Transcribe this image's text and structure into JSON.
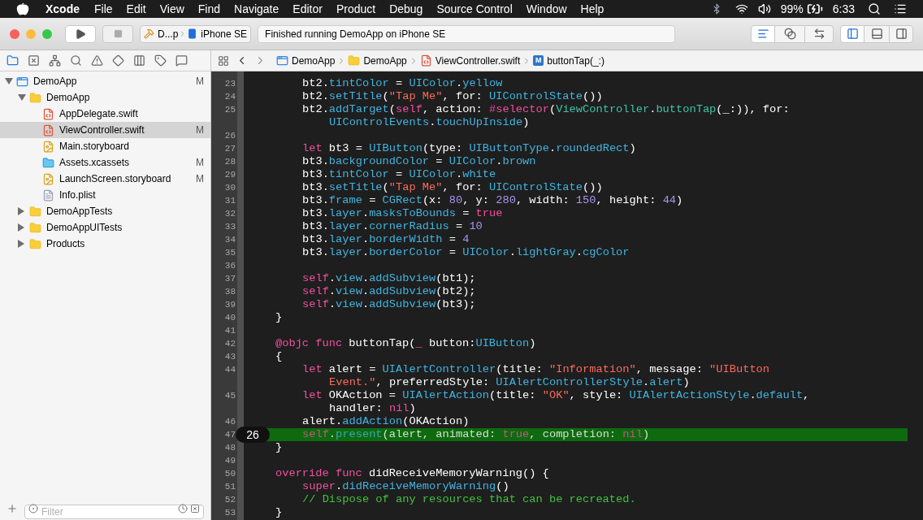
{
  "menu_bar": {
    "app": "Xcode",
    "items": [
      "File",
      "Edit",
      "View",
      "Find",
      "Navigate",
      "Editor",
      "Product",
      "Debug",
      "Source Control",
      "Window",
      "Help"
    ],
    "battery": "99%",
    "time": "6:33"
  },
  "toolbar": {
    "scheme": "D...p",
    "device": "iPhone SE",
    "activity": "Finished running DemoApp on iPhone SE"
  },
  "navigator_tabs": [
    {
      "kind": "project",
      "selected": true
    },
    {
      "kind": "source",
      "selected": false
    },
    {
      "kind": "symbol",
      "selected": false
    },
    {
      "kind": "find",
      "selected": false
    },
    {
      "kind": "issue",
      "selected": false
    },
    {
      "kind": "test",
      "selected": false
    },
    {
      "kind": "debug",
      "selected": false
    },
    {
      "kind": "breakpoint",
      "selected": false
    },
    {
      "kind": "report",
      "selected": false
    }
  ],
  "tree": [
    {
      "name": "DemoApp",
      "kind": "project",
      "status": "M",
      "selected": false,
      "expanded": true,
      "children": [
        {
          "name": "DemoApp",
          "kind": "folder",
          "selected": false,
          "expanded": true,
          "children": [
            {
              "name": "AppDelegate.swift",
              "kind": "swift",
              "selected": false
            },
            {
              "name": "ViewController.swift",
              "kind": "swift",
              "status": "M",
              "selected": true
            },
            {
              "name": "Main.storyboard",
              "kind": "storyboard",
              "selected": false
            },
            {
              "name": "Assets.xcassets",
              "kind": "assets",
              "status": "M",
              "selected": false
            },
            {
              "name": "LaunchScreen.storyboard",
              "kind": "storyboard",
              "status": "M",
              "selected": false
            },
            {
              "name": "Info.plist",
              "kind": "plist",
              "selected": false
            }
          ]
        },
        {
          "name": "DemoAppTests",
          "kind": "folder",
          "selected": false,
          "expanded": false
        },
        {
          "name": "DemoAppUITests",
          "kind": "folder",
          "selected": false,
          "expanded": false
        },
        {
          "name": "Products",
          "kind": "folder",
          "selected": false,
          "expanded": false
        }
      ]
    }
  ],
  "filter": {
    "placeholder": "Filter"
  },
  "breadcrumb": [
    {
      "text": "DemoApp",
      "kind": "project"
    },
    {
      "text": "DemoApp",
      "kind": "folder"
    },
    {
      "text": "ViewController.swift",
      "kind": "swift"
    },
    {
      "text": "buttonTap(_:)",
      "kind": "method",
      "badge": "M"
    }
  ],
  "code": [
    {
      "number": "23",
      "kind": "body",
      "tokens": [
        {
          "kind": "plain",
          "text": "bt2."
        },
        {
          "kind": "id",
          "text": "tintColor"
        },
        {
          "kind": "plain",
          "text": " = "
        },
        {
          "kind": "id",
          "text": "UIColor"
        },
        {
          "kind": "plain",
          "text": "."
        },
        {
          "kind": "id",
          "text": "yellow"
        }
      ]
    },
    {
      "number": "24",
      "kind": "body",
      "tokens": [
        {
          "kind": "plain",
          "text": "bt2."
        },
        {
          "kind": "id",
          "text": "setTitle"
        },
        {
          "kind": "plain",
          "text": "("
        },
        {
          "kind": "string",
          "text": "\"Tap Me\""
        },
        {
          "kind": "plain",
          "text": ", for: "
        },
        {
          "kind": "id",
          "text": "UIControlState"
        },
        {
          "kind": "plain",
          "text": "())"
        }
      ]
    },
    {
      "number": "25",
      "kind": "body",
      "tokens": [
        {
          "kind": "plain",
          "text": "bt2."
        },
        {
          "kind": "id",
          "text": "addTarget"
        },
        {
          "kind": "plain",
          "text": "("
        },
        {
          "kind": "keyword",
          "text": "self"
        },
        {
          "kind": "plain",
          "text": ", action: "
        },
        {
          "kind": "keyword",
          "text": "#selector"
        },
        {
          "kind": "plain",
          "text": "("
        },
        {
          "kind": "user",
          "text": "ViewController"
        },
        {
          "kind": "plain",
          "text": "."
        },
        {
          "kind": "user",
          "text": "buttonTap"
        },
        {
          "kind": "plain",
          "text": "(_:)), for:"
        }
      ]
    },
    {
      "kind": "wrap",
      "tokens": [
        {
          "kind": "id",
          "text": "UIControlEvents"
        },
        {
          "kind": "plain",
          "text": "."
        },
        {
          "kind": "id",
          "text": "touchUpInside"
        },
        {
          "kind": "plain",
          "text": ")"
        }
      ]
    },
    {
      "number": "26"
    },
    {
      "number": "27",
      "kind": "body",
      "tokens": [
        {
          "kind": "keyword",
          "text": "let"
        },
        {
          "kind": "plain",
          "text": " bt3 = "
        },
        {
          "kind": "id",
          "text": "UIButton"
        },
        {
          "kind": "plain",
          "text": "(type: "
        },
        {
          "kind": "id",
          "text": "UIButtonType"
        },
        {
          "kind": "plain",
          "text": "."
        },
        {
          "kind": "id",
          "text": "roundedRect"
        },
        {
          "kind": "plain",
          "text": ")"
        }
      ]
    },
    {
      "number": "28",
      "kind": "body",
      "tokens": [
        {
          "kind": "plain",
          "text": "bt3."
        },
        {
          "kind": "id",
          "text": "backgroundColor"
        },
        {
          "kind": "plain",
          "text": " = "
        },
        {
          "kind": "id",
          "text": "UIColor"
        },
        {
          "kind": "plain",
          "text": "."
        },
        {
          "kind": "id",
          "text": "brown"
        }
      ]
    },
    {
      "number": "29",
      "kind": "body",
      "tokens": [
        {
          "kind": "plain",
          "text": "bt3."
        },
        {
          "kind": "id",
          "text": "tintColor"
        },
        {
          "kind": "plain",
          "text": " = "
        },
        {
          "kind": "id",
          "text": "UIColor"
        },
        {
          "kind": "plain",
          "text": "."
        },
        {
          "kind": "id",
          "text": "white"
        }
      ]
    },
    {
      "number": "30",
      "kind": "body",
      "tokens": [
        {
          "kind": "plain",
          "text": "bt3."
        },
        {
          "kind": "id",
          "text": "setTitle"
        },
        {
          "kind": "plain",
          "text": "("
        },
        {
          "kind": "string",
          "text": "\"Tap Me\""
        },
        {
          "kind": "plain",
          "text": ", for: "
        },
        {
          "kind": "id",
          "text": "UIControlState"
        },
        {
          "kind": "plain",
          "text": "())"
        }
      ]
    },
    {
      "number": "31",
      "kind": "body",
      "tokens": [
        {
          "kind": "plain",
          "text": "bt3."
        },
        {
          "kind": "id",
          "text": "frame"
        },
        {
          "kind": "plain",
          "text": " = "
        },
        {
          "kind": "id",
          "text": "CGRect"
        },
        {
          "kind": "plain",
          "text": "(x: "
        },
        {
          "kind": "number",
          "text": "80"
        },
        {
          "kind": "plain",
          "text": ", y: "
        },
        {
          "kind": "number",
          "text": "280"
        },
        {
          "kind": "plain",
          "text": ", width: "
        },
        {
          "kind": "number",
          "text": "150"
        },
        {
          "kind": "plain",
          "text": ", height: "
        },
        {
          "kind": "number",
          "text": "44"
        },
        {
          "kind": "plain",
          "text": ")"
        }
      ]
    },
    {
      "number": "32",
      "kind": "body",
      "tokens": [
        {
          "kind": "plain",
          "text": "bt3."
        },
        {
          "kind": "id",
          "text": "layer"
        },
        {
          "kind": "plain",
          "text": "."
        },
        {
          "kind": "id",
          "text": "masksToBounds"
        },
        {
          "kind": "plain",
          "text": " = "
        },
        {
          "kind": "keyword",
          "text": "true"
        }
      ]
    },
    {
      "number": "33",
      "kind": "body",
      "tokens": [
        {
          "kind": "plain",
          "text": "bt3."
        },
        {
          "kind": "id",
          "text": "layer"
        },
        {
          "kind": "plain",
          "text": "."
        },
        {
          "kind": "id",
          "text": "cornerRadius"
        },
        {
          "kind": "plain",
          "text": " = "
        },
        {
          "kind": "number",
          "text": "10"
        }
      ]
    },
    {
      "number": "34",
      "kind": "body",
      "tokens": [
        {
          "kind": "plain",
          "text": "bt3."
        },
        {
          "kind": "id",
          "text": "layer"
        },
        {
          "kind": "plain",
          "text": "."
        },
        {
          "kind": "id",
          "text": "borderWidth"
        },
        {
          "kind": "plain",
          "text": " = "
        },
        {
          "kind": "number",
          "text": "4"
        }
      ]
    },
    {
      "number": "35",
      "kind": "body",
      "tokens": [
        {
          "kind": "plain",
          "text": "bt3."
        },
        {
          "kind": "id",
          "text": "layer"
        },
        {
          "kind": "plain",
          "text": "."
        },
        {
          "kind": "id",
          "text": "borderColor"
        },
        {
          "kind": "plain",
          "text": " = "
        },
        {
          "kind": "id",
          "text": "UIColor"
        },
        {
          "kind": "plain",
          "text": "."
        },
        {
          "kind": "id",
          "text": "lightGray"
        },
        {
          "kind": "plain",
          "text": "."
        },
        {
          "kind": "id",
          "text": "cgColor"
        }
      ]
    },
    {
      "number": "36"
    },
    {
      "number": "37",
      "kind": "body",
      "tokens": [
        {
          "kind": "keyword",
          "text": "self"
        },
        {
          "kind": "plain",
          "text": "."
        },
        {
          "kind": "id",
          "text": "view"
        },
        {
          "kind": "plain",
          "text": "."
        },
        {
          "kind": "id",
          "text": "addSubview"
        },
        {
          "kind": "plain",
          "text": "(bt1);"
        }
      ]
    },
    {
      "number": "38",
      "kind": "body",
      "tokens": [
        {
          "kind": "keyword",
          "text": "self"
        },
        {
          "kind": "plain",
          "text": "."
        },
        {
          "kind": "id",
          "text": "view"
        },
        {
          "kind": "plain",
          "text": "."
        },
        {
          "kind": "id",
          "text": "addSubview"
        },
        {
          "kind": "plain",
          "text": "(bt2);"
        }
      ]
    },
    {
      "number": "39",
      "kind": "body",
      "tokens": [
        {
          "kind": "keyword",
          "text": "self"
        },
        {
          "kind": "plain",
          "text": "."
        },
        {
          "kind": "id",
          "text": "view"
        },
        {
          "kind": "plain",
          "text": "."
        },
        {
          "kind": "id",
          "text": "addSubview"
        },
        {
          "kind": "plain",
          "text": "(bt3);"
        }
      ]
    },
    {
      "number": "40",
      "kind": "member",
      "tokens": [
        {
          "kind": "plain",
          "text": "}"
        }
      ]
    },
    {
      "number": "41"
    },
    {
      "number": "42",
      "kind": "member",
      "tokens": [
        {
          "kind": "keyword",
          "text": "@objc func"
        },
        {
          "kind": "plain",
          "text": " buttonTap("
        },
        {
          "kind": "keyword",
          "text": "_"
        },
        {
          "kind": "plain",
          "text": " button:"
        },
        {
          "kind": "id",
          "text": "UIButton"
        },
        {
          "kind": "plain",
          "text": ")"
        }
      ]
    },
    {
      "number": "43",
      "kind": "member",
      "tokens": [
        {
          "kind": "plain",
          "text": "{"
        }
      ]
    },
    {
      "number": "44",
      "kind": "body",
      "tokens": [
        {
          "kind": "keyword",
          "text": "let"
        },
        {
          "kind": "plain",
          "text": " alert = "
        },
        {
          "kind": "id",
          "text": "UIAlertController"
        },
        {
          "kind": "plain",
          "text": "(title: "
        },
        {
          "kind": "string",
          "text": "\"Information\""
        },
        {
          "kind": "plain",
          "text": ", message: "
        },
        {
          "kind": "string",
          "text": "\"UIButton"
        }
      ]
    },
    {
      "kind": "wrap",
      "tokens": [
        {
          "kind": "string",
          "text": "Event.\""
        },
        {
          "kind": "plain",
          "text": ", preferredStyle: "
        },
        {
          "kind": "id",
          "text": "UIAlertControllerStyle"
        },
        {
          "kind": "plain",
          "text": "."
        },
        {
          "kind": "id",
          "text": "alert"
        },
        {
          "kind": "plain",
          "text": ")"
        }
      ]
    },
    {
      "number": "45",
      "kind": "body",
      "tokens": [
        {
          "kind": "keyword",
          "text": "let"
        },
        {
          "kind": "plain",
          "text": " OKAction = "
        },
        {
          "kind": "id",
          "text": "UIAlertAction"
        },
        {
          "kind": "plain",
          "text": "(title: "
        },
        {
          "kind": "string",
          "text": "\"OK\""
        },
        {
          "kind": "plain",
          "text": ", style: "
        },
        {
          "kind": "id",
          "text": "UIAlertActionStyle"
        },
        {
          "kind": "plain",
          "text": "."
        },
        {
          "kind": "id",
          "text": "default"
        },
        {
          "kind": "plain",
          "text": ","
        }
      ]
    },
    {
      "kind": "wrap",
      "tokens": [
        {
          "kind": "plain",
          "text": "handler: "
        },
        {
          "kind": "keyword",
          "text": "nil"
        },
        {
          "kind": "plain",
          "text": ")"
        }
      ]
    },
    {
      "number": "46",
      "kind": "body",
      "tokens": [
        {
          "kind": "plain",
          "text": "alert."
        },
        {
          "kind": "id",
          "text": "addAction"
        },
        {
          "kind": "plain",
          "text": "(OKAction)"
        }
      ]
    },
    {
      "number": "47",
      "kind": "body",
      "highlighted": true,
      "thread": "26",
      "tokens": [
        {
          "kind": "keyword",
          "text": "self"
        },
        {
          "kind": "plain",
          "text": "."
        },
        {
          "kind": "id",
          "text": "present"
        },
        {
          "kind": "plain",
          "text": "(alert, animated: "
        },
        {
          "kind": "keyword",
          "text": "true"
        },
        {
          "kind": "plain",
          "text": ", completion: "
        },
        {
          "kind": "keyword",
          "text": "nil"
        },
        {
          "kind": "plain",
          "text": ")"
        }
      ]
    },
    {
      "number": "48",
      "kind": "member",
      "tokens": [
        {
          "kind": "plain",
          "text": "}"
        }
      ]
    },
    {
      "number": "49"
    },
    {
      "number": "50",
      "kind": "member",
      "tokens": [
        {
          "kind": "keyword",
          "text": "override func"
        },
        {
          "kind": "plain",
          "text": " didReceiveMemoryWarning() {"
        }
      ]
    },
    {
      "number": "51",
      "kind": "body",
      "tokens": [
        {
          "kind": "keyword",
          "text": "super"
        },
        {
          "kind": "plain",
          "text": "."
        },
        {
          "kind": "id",
          "text": "didReceiveMemoryWarning"
        },
        {
          "kind": "plain",
          "text": "()"
        }
      ]
    },
    {
      "number": "52",
      "kind": "body",
      "tokens": [
        {
          "kind": "comment",
          "text": "// Dispose of any resources that can be recreated."
        }
      ]
    },
    {
      "number": "53",
      "kind": "member",
      "tokens": [
        {
          "kind": "plain",
          "text": "}"
        }
      ]
    }
  ]
}
